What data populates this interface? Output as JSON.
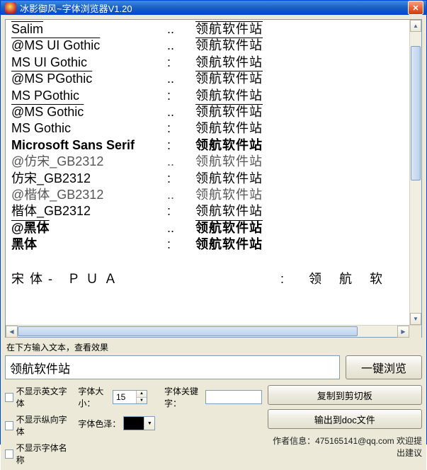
{
  "window": {
    "title": "冰影御风~字体浏览器V1.20"
  },
  "font_rows": [
    {
      "name": "Salim",
      "colon": "..",
      "sample": "领航软件站",
      "cls": "decor"
    },
    {
      "name": "@MS UI Gothic",
      "colon": "..",
      "sample": "领航软件站",
      "cls": "decor"
    },
    {
      "name": "MS UI Gothic",
      "colon": ":",
      "sample": "领航软件站",
      "cls": ""
    },
    {
      "name": "@MS PGothic",
      "colon": "..",
      "sample": "领航软件站",
      "cls": "decor"
    },
    {
      "name": "MS PGothic",
      "colon": ":",
      "sample": "领航软件站",
      "cls": ""
    },
    {
      "name": "@MS Gothic",
      "colon": "..",
      "sample": "领航软件站",
      "cls": "decor"
    },
    {
      "name": "MS Gothic",
      "colon": ":",
      "sample": "领航软件站",
      "cls": ""
    },
    {
      "name": "Microsoft Sans Serif",
      "colon": ":",
      "sample": "领航软件站",
      "cls": "bold"
    },
    {
      "name": "@仿宋_GB2312",
      "colon": "..",
      "sample": "领航软件站",
      "cls": "gray"
    },
    {
      "name": "仿宋_GB2312",
      "colon": ":",
      "sample": "领航软件站",
      "cls": ""
    },
    {
      "name": "@楷体_GB2312",
      "colon": "..",
      "sample": "领航软件站",
      "cls": "gray"
    },
    {
      "name": "楷体_GB2312",
      "colon": ":",
      "sample": "领航软件站",
      "cls": ""
    },
    {
      "name": "@黑体",
      "colon": "..",
      "sample": "领航软件站",
      "cls": "bold decor"
    },
    {
      "name": "黑体",
      "colon": ":",
      "sample": "领航软件站",
      "cls": "bold"
    }
  ],
  "sep_row": {
    "name": "宋体- ＰＵＡ",
    "colon": ":",
    "sample": "领 航 软"
  },
  "controls": {
    "input_label": "在下方输入文本，查看效果",
    "input_value": "领航软件站",
    "browse_btn": "一键浏览",
    "copy_btn": "复制到剪切板",
    "export_btn": "输出到doc文件",
    "chk_no_english": "不显示英文字体",
    "chk_no_vertical": "不显示纵向字体",
    "chk_no_name": "不显示字体名称",
    "font_size_label": "字体大小：",
    "font_size_value": "15",
    "font_keyword_label": "字体关键字：",
    "font_keyword_value": "",
    "font_color_label": "字体色泽：",
    "font_color_value": "#000000"
  },
  "footer": "作者信息：475165141@qq.com  欢迎提出建议"
}
